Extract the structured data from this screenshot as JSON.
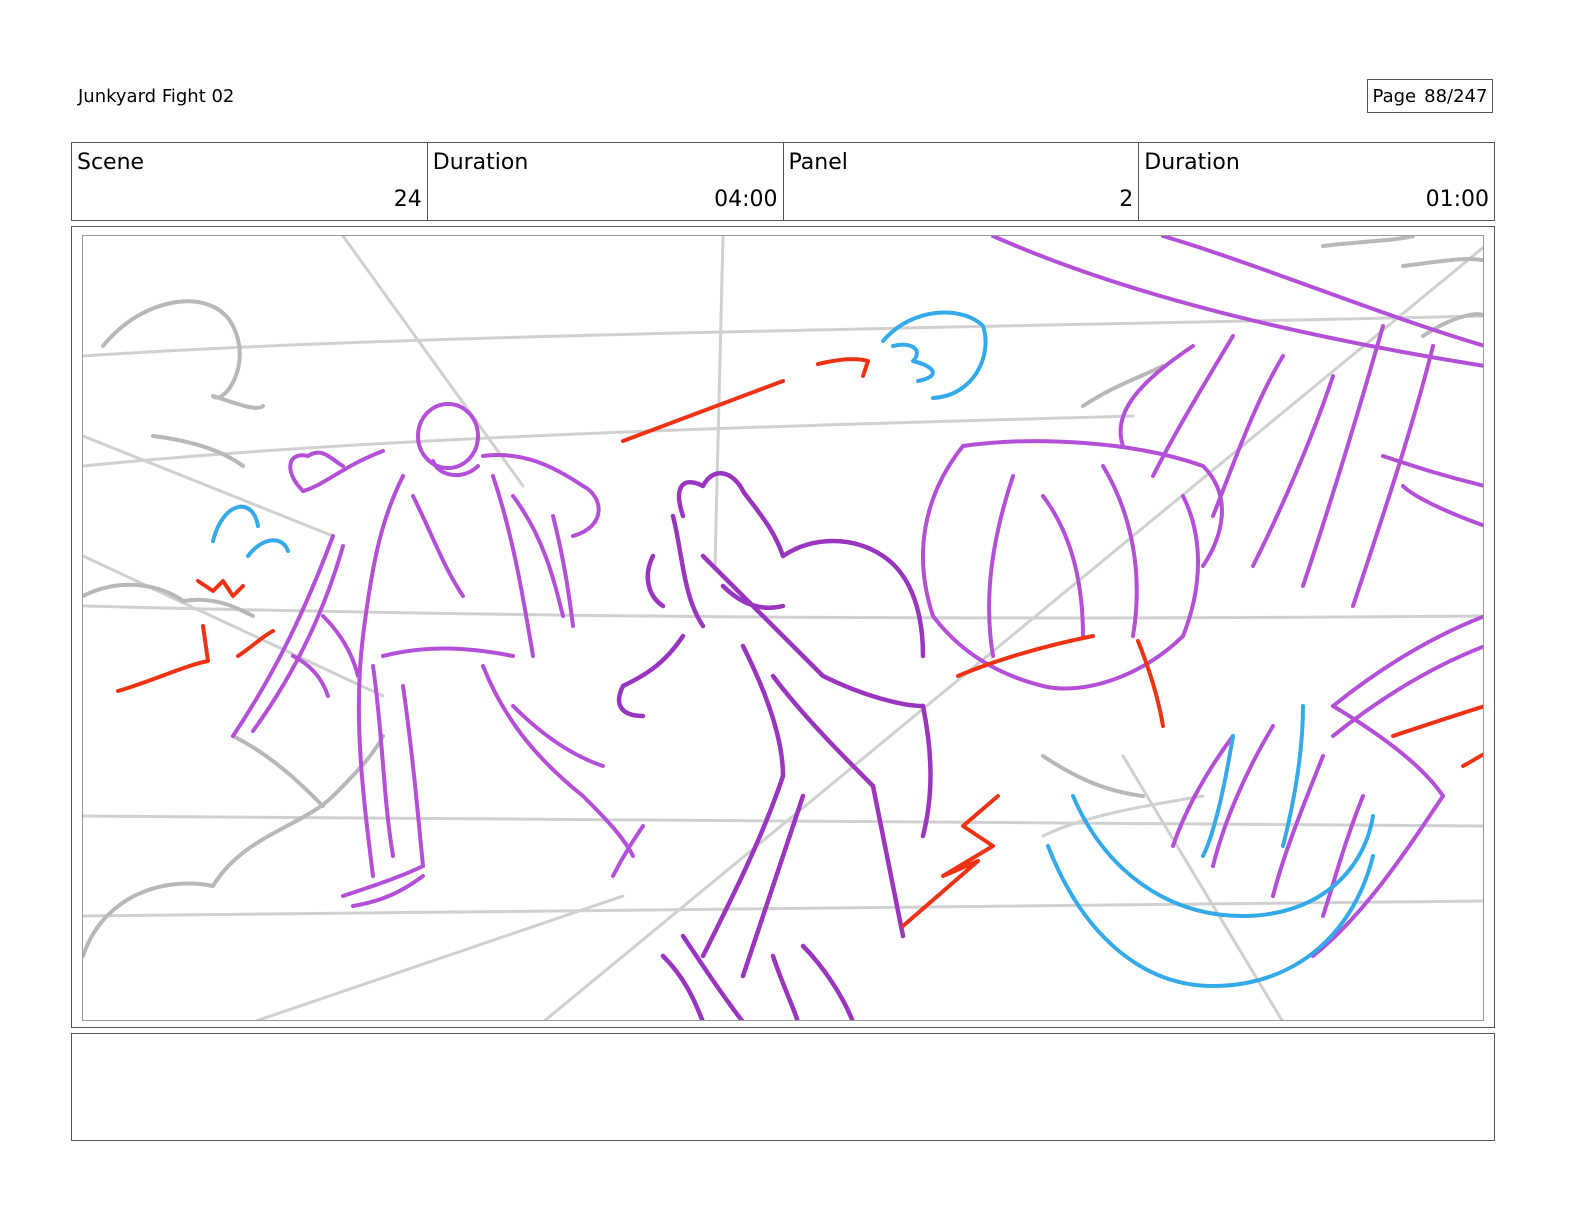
{
  "document": {
    "title": "Junkyard Fight 02"
  },
  "page": {
    "label": "Page",
    "number": "88/247"
  },
  "info": [
    {
      "label": "Scene",
      "value": "24"
    },
    {
      "label": "Duration",
      "value": "04:00"
    },
    {
      "label": "Panel",
      "value": "2"
    },
    {
      "label": "Duration",
      "value": "01:00"
    }
  ],
  "sketch": {
    "line_colors": {
      "guides": "#d0d0d0",
      "clouds": "#b8b8b8",
      "characters": "#b44fd8",
      "foreground_character": "#9a35c0",
      "action": "#ee3314",
      "effects": "#35aaea"
    }
  },
  "notes": {
    "text": ""
  }
}
